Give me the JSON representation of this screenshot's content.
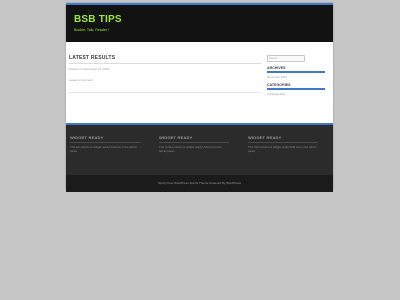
{
  "site": {
    "title": "BSB TIPS",
    "tagline": "Bookie, Talk, Reader !"
  },
  "main": {
    "title": "LATEST RESULTS",
    "meta": "Posted on December 11, 2012",
    "comments": "Leave a comment"
  },
  "sidebar": {
    "search_placeholder": "Search ...",
    "archives_title": "ARCHIVES",
    "archives_item": "December 2012",
    "categories_title": "CATEGORIES",
    "categories_item": "Uncategorized"
  },
  "footer_widgets": [
    {
      "title": "WIDGET READY",
      "text": "This left column is widget ready! Add one in the admin panel."
    },
    {
      "title": "WIDGET READY",
      "text": "This center column is widget ready! Add one in the admin panel."
    },
    {
      "title": "WIDGET READY",
      "text": "This right column is widget ready! Add one in the admin panel."
    }
  ],
  "credits": "Sporty host WordPress Sports Theme Powered By WordPress",
  "colors": {
    "accent": "#3f79c8",
    "title_green": "#9be93a",
    "header_bg": "#121212",
    "page_bg": "#c6c6c6"
  }
}
